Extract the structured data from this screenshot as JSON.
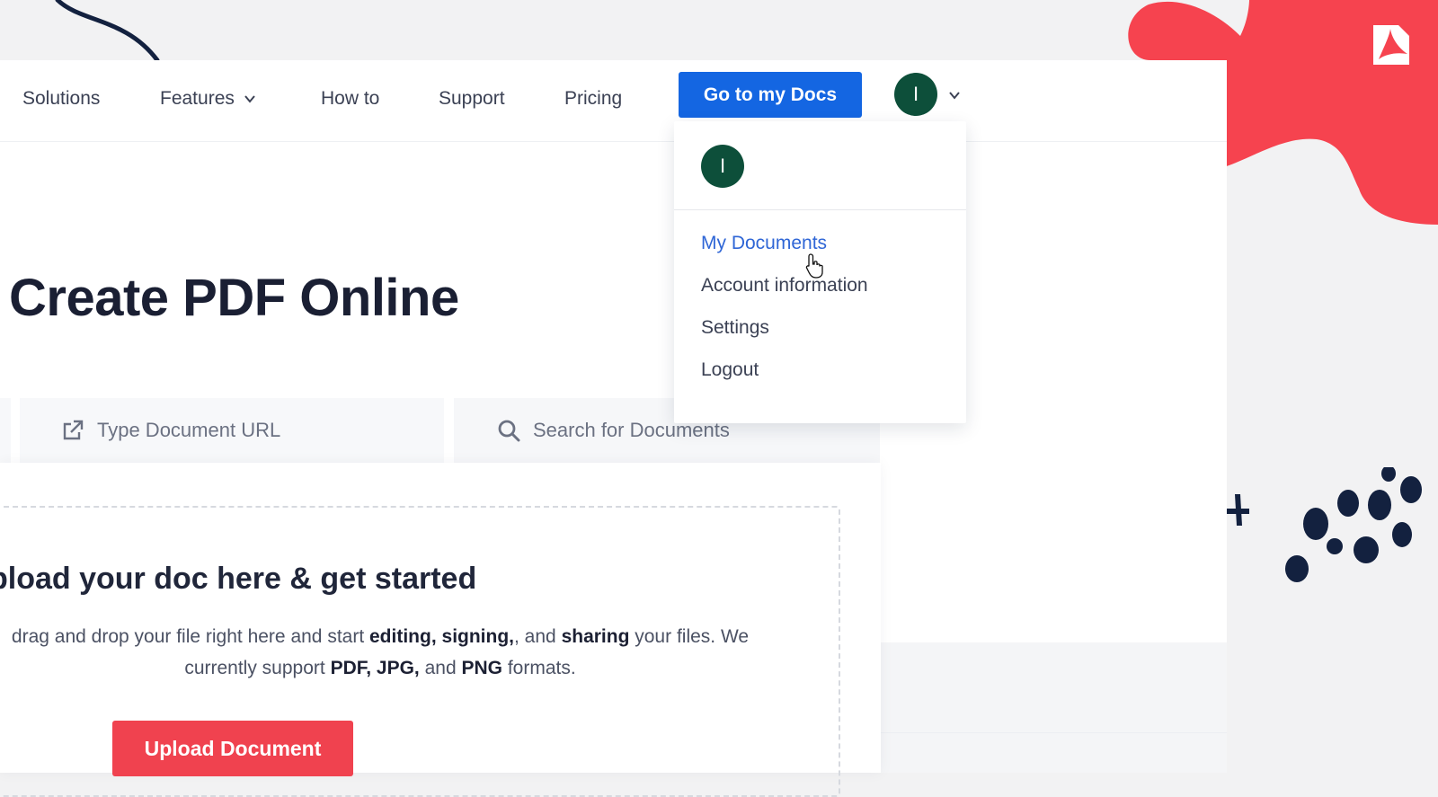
{
  "brand": {
    "logo_icon": "pdf-logo-icon",
    "accent": "#1466e2",
    "danger": "#f0424f",
    "avatar_bg": "#0d4f3a"
  },
  "nav": {
    "items": [
      "Solutions",
      "Features",
      "How to",
      "Support",
      "Pricing"
    ],
    "features_icon": "chevron-down-icon",
    "cta": "Go to my Docs",
    "avatar_initial": "I"
  },
  "dropdown": {
    "avatar_initial": "I",
    "items": [
      "My Documents",
      "Account information",
      "Settings",
      "Logout"
    ],
    "active_item": "My Documents"
  },
  "hero": {
    "title": "Create PDF Online"
  },
  "tabs": {
    "url": {
      "label": "Type Document URL",
      "icon": "external-link-icon"
    },
    "search": {
      "label": "Search for Documents",
      "icon": "search-icon"
    }
  },
  "upload": {
    "heading": "pload your doc here & get started",
    "desc": {
      "t1": "drag and drop your file right here and start ",
      "b1": "editing,",
      "b2": "signing,",
      "t2": ", and ",
      "b3": "sharing",
      "t3": " your files. We currently support ",
      "b4": "PDF, JPG,",
      "t4": " and ",
      "b5": "PNG",
      "t5": " formats."
    },
    "button": "Upload Document"
  }
}
